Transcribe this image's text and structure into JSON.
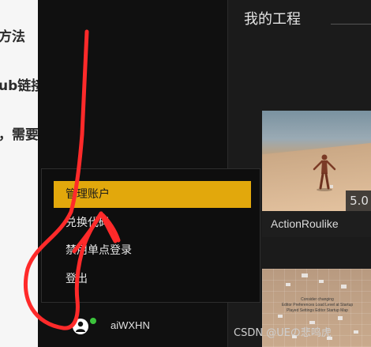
{
  "article": {
    "lines": [
      "方法",
      "ub链接",
      "，需要"
    ]
  },
  "main": {
    "title": "我的工程",
    "projects": [
      {
        "name": "ActionRoulike",
        "version": "5.0"
      }
    ],
    "second_thumb_caption": "Consider changing\nEditor Preferences Load Level at Startup\nPlayed Settings Editor Startup Map"
  },
  "menu": {
    "items": [
      {
        "label": "管理账户",
        "active": true
      },
      {
        "label": "兑换代码"
      },
      {
        "label": "禁用单点登录"
      },
      {
        "label": "登出"
      }
    ]
  },
  "user": {
    "name": "aiWXHN",
    "status": "online"
  },
  "watermark": "CSDN @UEの悲鸣虎",
  "colors": {
    "accent": "#e2a80c",
    "online": "#3cc43c",
    "annotation": "#ff2a2a"
  },
  "icons": {
    "avatar": "user-avatar-icon"
  }
}
